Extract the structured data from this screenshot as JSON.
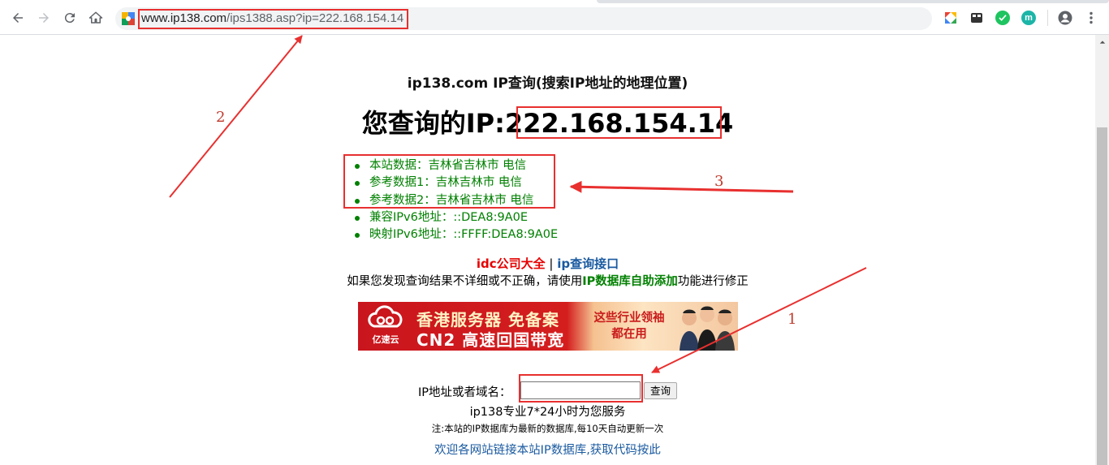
{
  "browser": {
    "url_host": "www.ip138.com",
    "url_path": "/ips1388.asp?ip=222.168.154.14",
    "extensions": [
      "colorful-ext-icon",
      "tab-ext-icon",
      "green-check-ext-icon",
      "teal-m-ext-icon"
    ],
    "ext_m_letter": "m"
  },
  "page": {
    "heading": "ip138.com IP查询(搜索IP地址的地理位置)",
    "ip_prefix": "您查询的IP:",
    "ip_value": "222.168.154.14",
    "results": [
      "本站数据：吉林省吉林市 电信",
      "参考数据1：吉林吉林市 电信",
      "参考数据2：吉林省吉林市 电信",
      "兼容IPv6地址：::DEA8:9A0E",
      "映射IPv6地址：::FFFF:DEA8:9A0E"
    ],
    "link_idc": "idc公司大全",
    "link_sep": " | ",
    "link_api": "ip查询接口",
    "fix_prefix": "如果您发现查询结果不详细或不正确，请使用",
    "fix_link": "IP数据库自助添加",
    "fix_suffix": "功能进行修正",
    "query_label": "IP地址或者域名：",
    "query_value": "",
    "query_button": "查询",
    "service_text": "ip138专业7*24小时为您服务",
    "note_text": "注:本站的IP数据库为最新的数据库,每10天自动更新一次",
    "welcome_text": "欢迎各网站链接本站IP数据库,获取代码按此"
  },
  "banner": {
    "logo_text": "亿速云",
    "line1": "香港服务器 免备案",
    "line2": "CN2 高速回国带宽",
    "slogan_1": "这些行业领袖",
    "slogan_2": "都在用"
  },
  "annotations": {
    "label_1": "1",
    "label_2": "2",
    "label_3": "3",
    "color": "#e8302f"
  }
}
